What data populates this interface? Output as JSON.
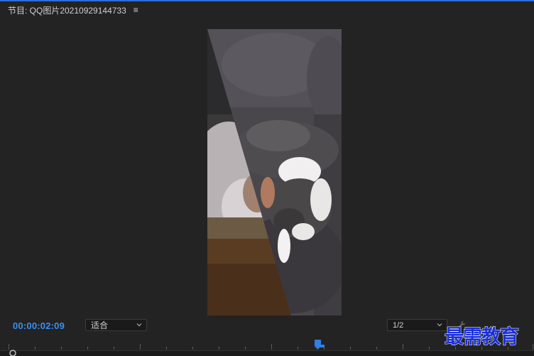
{
  "panel": {
    "title": "节目: QQ图片20210929144733",
    "menu_icon": "hamburger-menu-icon"
  },
  "viewer": {
    "content": "program-monitor-frame"
  },
  "controls": {
    "timecode": "00:00:02:09",
    "fit_label": "适合",
    "resolution_label": "1/2",
    "settings_icon": "wrench-icon"
  },
  "watermark": {
    "text": "最需教育"
  },
  "colors": {
    "background": "#232323",
    "accent": "#2a6fd6",
    "timecode": "#3b8ff2",
    "playhead": "#2f7fe6"
  }
}
